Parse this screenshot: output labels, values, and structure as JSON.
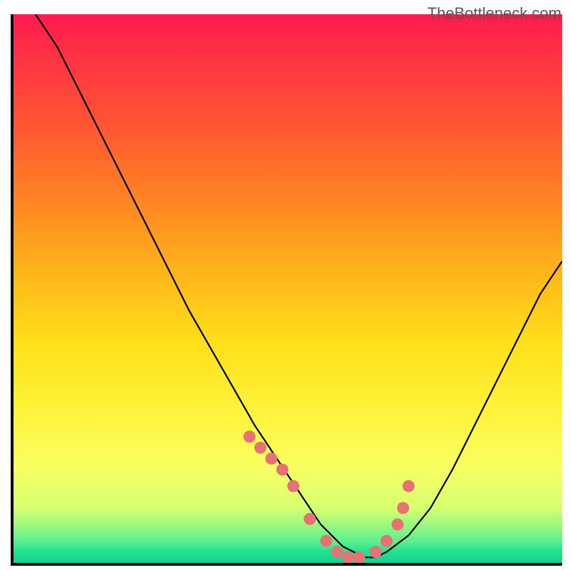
{
  "attribution": "TheBottleneck.com",
  "chart_data": {
    "type": "line",
    "title": "",
    "xlabel": "",
    "ylabel": "",
    "xlim": [
      0,
      100
    ],
    "ylim": [
      0,
      100
    ],
    "x": [
      4,
      8,
      12,
      16,
      20,
      24,
      28,
      32,
      36,
      40,
      44,
      48,
      52,
      54,
      56,
      58,
      60,
      62,
      64,
      66,
      68,
      72,
      76,
      80,
      84,
      88,
      92,
      96,
      100
    ],
    "values": [
      100,
      94,
      86,
      78,
      70,
      62,
      54,
      46,
      39,
      32,
      25,
      19,
      13,
      10,
      7,
      5,
      3,
      2,
      1,
      1,
      2,
      5,
      10,
      17,
      25,
      33,
      41,
      49,
      55
    ],
    "markers": {
      "x": [
        43,
        45,
        47,
        49,
        51,
        54,
        57,
        59,
        61,
        63,
        66,
        68,
        70,
        71,
        72
      ],
      "y": [
        23,
        21,
        19,
        17,
        14,
        8,
        4,
        2,
        1,
        1,
        2,
        4,
        7,
        10,
        14
      ]
    },
    "marker_color": "#e57373",
    "background_gradient": [
      "#ff1a4d",
      "#ffe01a",
      "#20e090"
    ]
  }
}
